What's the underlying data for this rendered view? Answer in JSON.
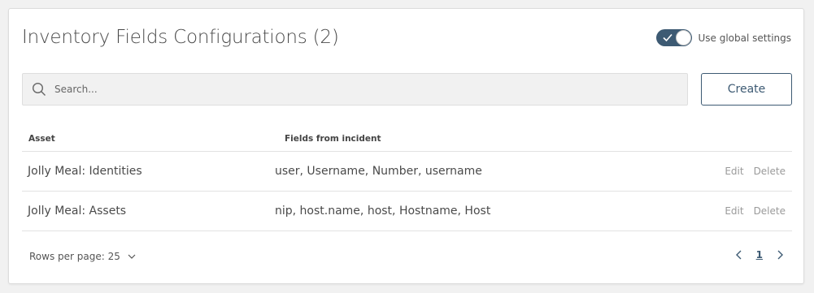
{
  "header": {
    "title": "Inventory Fields Configurations (2)",
    "toggle_label": "Use global settings",
    "toggle_on": true
  },
  "search": {
    "placeholder": "Search..."
  },
  "toolbar": {
    "create_label": "Create"
  },
  "table": {
    "columns": [
      "Asset",
      "Fields from incident"
    ],
    "rows": [
      {
        "asset": "Jolly Meal: Identities",
        "fields": "user, Username, Number, username",
        "edit": "Edit",
        "delete": "Delete"
      },
      {
        "asset": "Jolly Meal: Assets",
        "fields": "nip, host.name, host, Hostname, Host",
        "edit": "Edit",
        "delete": "Delete"
      }
    ]
  },
  "pagination": {
    "rows_per_page_label": "Rows per page: 25",
    "current_page": "1"
  },
  "colors": {
    "accent": "#3d5a73",
    "page_background": "#f1f1f1",
    "muted_text": "#9a9a9a"
  },
  "icons": [
    "search-icon",
    "check-icon",
    "chevron-down-icon",
    "chevron-left-icon",
    "chevron-right-icon"
  ]
}
